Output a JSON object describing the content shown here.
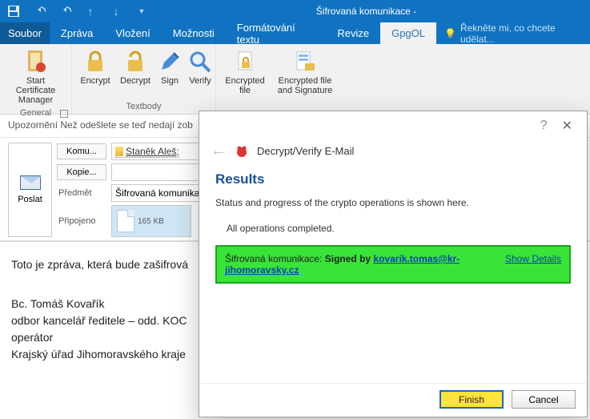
{
  "window_title": "Šifrovaná komunikace -",
  "tabs": {
    "file": "Soubor",
    "zprava": "Zpráva",
    "vlozeni": "Vložení",
    "moznosti": "Možnosti",
    "format": "Formátování textu",
    "revize": "Revize",
    "gpgol": "GpgOL",
    "tell_me": "Řekněte mi, co chcete udělat..."
  },
  "ribbon": {
    "general": "General",
    "textbody": "Textbody",
    "start_cert_1": "Start Certificate",
    "start_cert_2": "Manager",
    "encrypt": "Encrypt",
    "decrypt": "Decrypt",
    "sign": "Sign",
    "verify": "Verify",
    "enc_file_1": "Encrypted",
    "enc_file_2": "file",
    "enc_file_sig_1": "Encrypted file",
    "enc_file_sig_2": "and Signature"
  },
  "compose": {
    "notice": "Upozornění Než odešlete se teď nedají zob",
    "send": "Poslat",
    "to_btn": "Komu...",
    "cc_btn": "Kopie...",
    "subject_lbl": "Předmět",
    "attached_lbl": "Připojeno",
    "recipient": "Staněk Aleš;",
    "subject_value": "Šifrovaná komunika",
    "attachment_size": "165 KB",
    "body_line1": "Toto je zpráva, která bude zašifrová",
    "sig1": "Bc. Tomáš Kovařík",
    "sig2": "odbor kancelář ředitele – odd. KOC",
    "sig3": "operátor",
    "sig4": "Krajský úřad Jihomoravského kraje"
  },
  "dialog": {
    "title": "Decrypt/Verify E-Mail",
    "results": "Results",
    "status_line": "Status and progress of the crypto operations is shown here.",
    "ops_done": "All operations completed.",
    "result_prefix": "Šifrovaná komunikace: ",
    "signed_by": "Signed by ",
    "signer": "kovarik.tomas@kr-jihomoravsky.cz",
    "show_details": "Show Details",
    "finish": "Finish",
    "cancel": "Cancel"
  }
}
